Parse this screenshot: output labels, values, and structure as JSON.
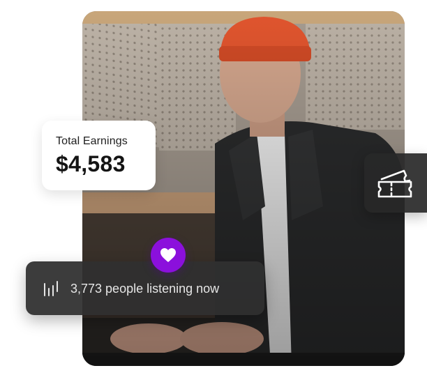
{
  "earnings": {
    "label": "Total Earnings",
    "value": "$4,583"
  },
  "listening": {
    "text": "3,773 people listening now",
    "icon": "audio-bars-icon"
  },
  "badges": {
    "heart_icon": "heart-icon",
    "ticket_icon": "ticket-icon"
  },
  "colors": {
    "accent": "#8b10dc",
    "card_dark": "#303030",
    "card_light": "#ffffff",
    "beanie": "#e0552e"
  }
}
